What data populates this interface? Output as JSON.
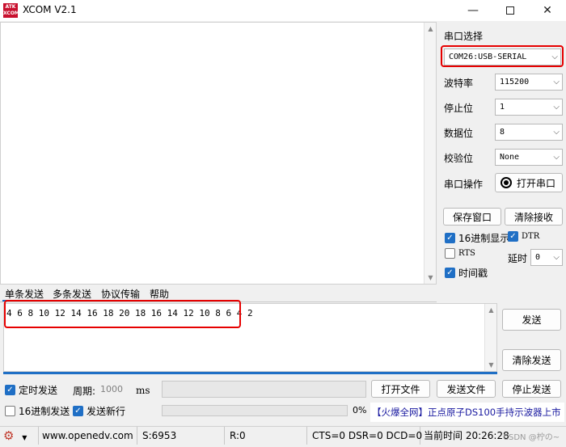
{
  "window": {
    "title": "XCOM V2.1",
    "logo_text": "ATK XCOM"
  },
  "right_panel": {
    "port_select_label": "串口选择",
    "port_value": "COM26:USB-SERIAL",
    "baud_label": "波特率",
    "baud_value": "115200",
    "stop_label": "停止位",
    "stop_value": "1",
    "data_label": "数据位",
    "data_value": "8",
    "parity_label": "校验位",
    "parity_value": "None",
    "op_label": "串口操作",
    "open_port_label": "打开串口",
    "save_window_label": "保存窗口",
    "clear_recv_label": "清除接收",
    "hex_display_label": "16进制显示",
    "hex_display_checked": true,
    "dtr_label": "DTR",
    "dtr_checked": true,
    "rts_label": "RTS",
    "rts_checked": false,
    "delay_label": "延时",
    "delay_value": "0",
    "timestamp_label": "时间戳",
    "timestamp_checked": true
  },
  "tabs": [
    "单条发送",
    "多条发送",
    "协议传输",
    "帮助"
  ],
  "send": {
    "text": "4 6 8 10 12 14 16 18 20 18 16 14 12 10 8 6 4 2",
    "send_label": "发送",
    "clear_send_label": "清除发送"
  },
  "bottom": {
    "timed_send_label": "定时发送",
    "timed_send_checked": true,
    "period_label": "周期:",
    "period_value": "1000",
    "period_unit": "ms",
    "open_file_label": "打开文件",
    "send_file_label": "发送文件",
    "stop_send_label": "停止发送",
    "hex_send_label": "16进制发送",
    "hex_send_checked": false,
    "newline_label": "发送新行",
    "newline_checked": true,
    "progress_percent": "0%",
    "ad_text": "【火爆全网】正点原子DS100手持示波器上市"
  },
  "status": {
    "website": "www.openedv.com",
    "sent": "S:6953",
    "received": "R:0",
    "signals": "CTS=0 DSR=0 DCD=0",
    "time_label": "当前时间 20:26:28",
    "watermark": "CSDN @柠の~"
  },
  "colors": {
    "accent": "#1f6fc5",
    "highlight": "#e60000",
    "ad_text": "#1a1aa0"
  }
}
